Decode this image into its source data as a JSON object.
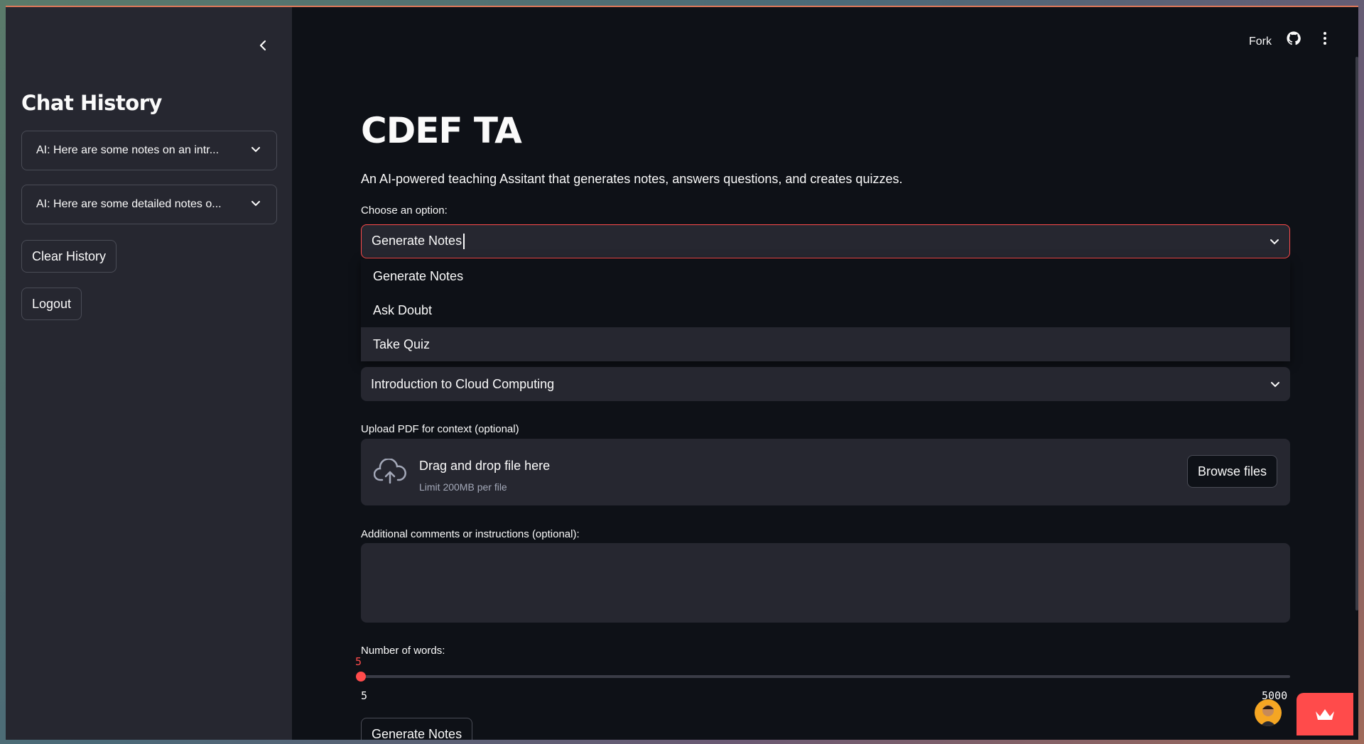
{
  "sidebar": {
    "title": "Chat History",
    "history": [
      {
        "label": "AI: Here are some notes on an intr..."
      },
      {
        "label": "AI: Here are some detailed notes o..."
      }
    ],
    "clear_label": "Clear History",
    "logout_label": "Logout"
  },
  "topbar": {
    "fork_label": "Fork"
  },
  "main": {
    "title": "CDEF TA",
    "description": "An AI-powered teaching Assitant that generates notes, answers questions, and creates quizzes.",
    "option_label": "Choose an option:",
    "option_value": "Generate Notes",
    "options": [
      "Generate Notes",
      "Ask Doubt",
      "Take Quiz"
    ],
    "topic_value": "Introduction to Cloud Computing",
    "upload_label": "Upload PDF for context (optional)",
    "upload_main": "Drag and drop file here",
    "upload_sub": "Limit 200MB per file",
    "browse_label": "Browse files",
    "comments_label": "Additional comments or instructions (optional):",
    "words_label": "Number of words:",
    "words_value": "5",
    "words_min": "5",
    "words_max": "5000",
    "generate_label": "Generate Notes"
  },
  "colors": {
    "accent": "#ff4b4b",
    "background": "#0e1117",
    "sidebar": "#262730"
  }
}
